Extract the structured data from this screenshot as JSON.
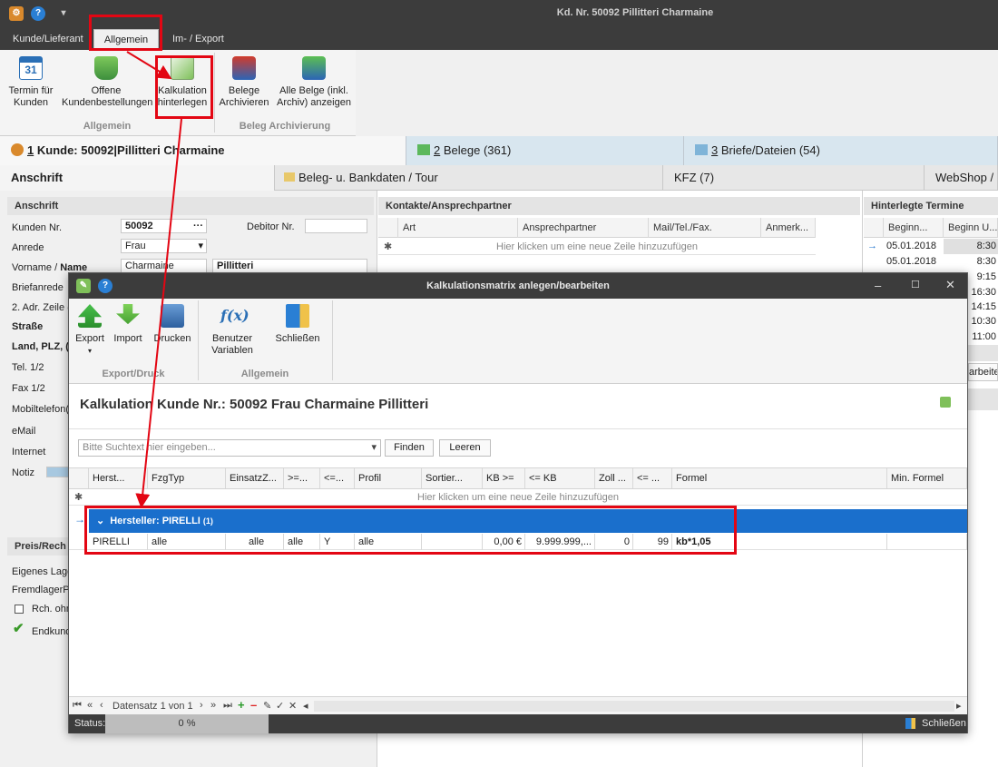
{
  "window": {
    "title": "Kd. Nr. 50092 Pillitteri Charmaine"
  },
  "ribbon_tabs": [
    {
      "label": "Kunde/Lieferant",
      "active": false
    },
    {
      "label": "Allgemein",
      "active": true
    },
    {
      "label": "Im- / Export",
      "active": false
    }
  ],
  "ribbon": {
    "buttons": [
      {
        "label": "Termin für Kunden",
        "icon": "calendar-icon"
      },
      {
        "label": "Offene Kundenbestellungen",
        "icon": "cart-icon"
      },
      {
        "label": "Kalkulation hinterlegen",
        "icon": "calculation-icon"
      },
      {
        "label": "Belege Archivieren",
        "icon": "archive-icon"
      },
      {
        "label": "Alle Belge (inkl. Archiv) anzeigen",
        "icon": "archive-show-icon"
      }
    ],
    "groups": [
      "Allgemein",
      "Beleg Archivierung"
    ]
  },
  "customer_tabs": [
    {
      "num": "1",
      "label": "Kunde: 50092|Pillitteri Charmaine"
    },
    {
      "num": "2",
      "label": "Belege (361)"
    },
    {
      "num": "3",
      "label": "Briefe/Dateien (54)"
    }
  ],
  "sub_tabs": [
    "Anschrift",
    "Beleg- u. Bankdaten / Tour",
    "KFZ (7)",
    "WebShop / S"
  ],
  "address": {
    "section_title": "Anschrift",
    "kunden_nr_label": "Kunden Nr.",
    "kunden_nr_value": "50092",
    "debitor_label": "Debitor Nr.",
    "anrede_label": "Anrede",
    "anrede_value": "Frau",
    "vorname_label": "Vorname /",
    "name_label": "Name",
    "vorname_value": "Charmaine",
    "name_value": "Pillitteri",
    "labels": [
      "Briefanrede",
      "2. Adr. Zeile (",
      "Straße",
      "Land, PLZ, (",
      "Tel. 1/2",
      "Fax 1/2",
      "Mobiltelefon(",
      "eMail",
      "Internet",
      "Notiz"
    ],
    "price_section": "Preis/Rech",
    "price_labels": [
      "Eigenes Lage",
      "FremdlagerPr",
      "Rch. ohn",
      "Endkund"
    ]
  },
  "contacts": {
    "title": "Kontakte/Ansprechpartner",
    "columns": [
      "Art",
      "Ansprechpartner",
      "Mail/Tel./Fax.",
      "Anmerk..."
    ],
    "new_row": "Hier klicken um eine neue Zeile hinzuzufügen"
  },
  "appointments": {
    "title": "Hinterlegte Termine",
    "columns": [
      "Beginn...",
      "Beginn U..."
    ],
    "rows": [
      {
        "date": "05.01.2018",
        "time": "8:30"
      },
      {
        "date": "05.01.2018",
        "time": "8:30"
      },
      {
        "date": "",
        "time": "9:15"
      },
      {
        "date": "",
        "time": "16:30"
      },
      {
        "date": "",
        "time": "14:15"
      },
      {
        "date": "",
        "time": "10:30"
      },
      {
        "date": "",
        "time": "11:00"
      }
    ],
    "edit_label": "arbeiten"
  },
  "modal": {
    "title": "Kalkulationsmatrix anlegen/bearbeiten",
    "ribbon_buttons": [
      {
        "label": "Export",
        "icon": "export-icon"
      },
      {
        "label": "Import",
        "icon": "import-icon"
      },
      {
        "label": "Drucken",
        "icon": "print-icon"
      },
      {
        "label": "Benutzer Variablen",
        "icon": "function-icon"
      },
      {
        "label": "Schließen",
        "icon": "exit-icon"
      }
    ],
    "groups": [
      "Export/Druck",
      "Allgemein"
    ],
    "heading": "Kalkulation Kunde Nr.: 50092 Frau Charmaine Pillitteri",
    "search_placeholder": "Bitte Suchtext hier eingeben...",
    "find_label": "Finden",
    "clear_label": "Leeren",
    "columns": [
      "Herst...",
      "FzgTyp",
      "EinsatzZ...",
      ">=...",
      "<=...",
      "Profil",
      "Sortier...",
      "KB >=",
      "<= KB",
      "Zoll ...",
      "<= ...",
      "Formel",
      "Min. Formel"
    ],
    "new_row": "Hier klicken um eine neue Zeile hinzuzufügen",
    "group_label": "Hersteller: PIRELLI",
    "group_count": "(1)",
    "row": [
      "PIRELLI",
      "alle",
      "alle",
      "alle",
      "Y",
      "alle",
      "",
      "0,00 €",
      "9.999.999,...",
      "0",
      "99",
      "kb*1,05",
      ""
    ],
    "nav_label": "Datensatz 1 von 1",
    "status_label": "Status:",
    "status_value": "0 %",
    "close_label": "Schließen"
  },
  "colors": {
    "accent": "#1a6fcc",
    "highlight": "#e30613",
    "dark": "#3c3c3c"
  }
}
